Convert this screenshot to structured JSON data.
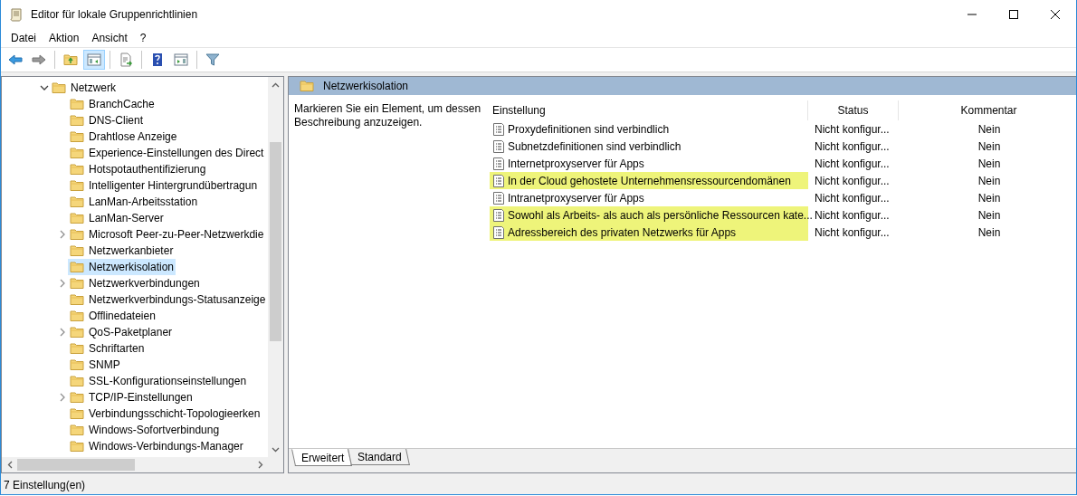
{
  "window": {
    "title": "Editor für lokale Gruppenrichtlinien"
  },
  "menu": [
    "Datei",
    "Aktion",
    "Ansicht",
    "?"
  ],
  "toolbar": [
    {
      "kind": "back",
      "pressed": false
    },
    {
      "kind": "forward",
      "pressed": false
    },
    {
      "kind": "sep"
    },
    {
      "kind": "up",
      "pressed": false
    },
    {
      "kind": "tree",
      "pressed": true
    },
    {
      "kind": "sep"
    },
    {
      "kind": "export",
      "pressed": false
    },
    {
      "kind": "sep"
    },
    {
      "kind": "help",
      "pressed": false
    },
    {
      "kind": "actionpane",
      "pressed": false
    },
    {
      "kind": "sep"
    },
    {
      "kind": "filter",
      "pressed": false
    }
  ],
  "tree": {
    "label": "Netzwerk",
    "expanded": true,
    "selected": false,
    "children": [
      {
        "label": "BranchCache",
        "expandable": false,
        "selected": false
      },
      {
        "label": "DNS-Client",
        "expandable": false,
        "selected": false
      },
      {
        "label": "Drahtlose Anzeige",
        "expandable": false,
        "selected": false
      },
      {
        "label": "Experience-Einstellungen des Direct",
        "expandable": false,
        "selected": false
      },
      {
        "label": "Hotspotauthentifizierung",
        "expandable": false,
        "selected": false
      },
      {
        "label": "Intelligenter Hintergrundübertragun",
        "expandable": false,
        "selected": false
      },
      {
        "label": "LanMan-Arbeitsstation",
        "expandable": false,
        "selected": false
      },
      {
        "label": "LanMan-Server",
        "expandable": false,
        "selected": false
      },
      {
        "label": "Microsoft Peer-zu-Peer-Netzwerkdie",
        "expandable": true,
        "selected": false
      },
      {
        "label": "Netzwerkanbieter",
        "expandable": false,
        "selected": false
      },
      {
        "label": "Netzwerkisolation",
        "expandable": false,
        "selected": true
      },
      {
        "label": "Netzwerkverbindungen",
        "expandable": true,
        "selected": false
      },
      {
        "label": "Netzwerkverbindungs-Statusanzeige",
        "expandable": false,
        "selected": false
      },
      {
        "label": "Offlinedateien",
        "expandable": false,
        "selected": false
      },
      {
        "label": "QoS-Paketplaner",
        "expandable": true,
        "selected": false
      },
      {
        "label": "Schriftarten",
        "expandable": false,
        "selected": false
      },
      {
        "label": "SNMP",
        "expandable": false,
        "selected": false
      },
      {
        "label": "SSL-Konfigurationseinstellungen",
        "expandable": false,
        "selected": false
      },
      {
        "label": "TCP/IP-Einstellungen",
        "expandable": true,
        "selected": false
      },
      {
        "label": "Verbindungsschicht-Topologieerken",
        "expandable": false,
        "selected": false
      },
      {
        "label": "Windows-Sofortverbindung",
        "expandable": false,
        "selected": false
      },
      {
        "label": "Windows-Verbindungs-Manager",
        "expandable": false,
        "selected": false
      }
    ]
  },
  "details": {
    "title": "Netzwerkisolation",
    "description": "Markieren Sie ein Element, um dessen Beschreibung anzuzeigen.",
    "columns": [
      "Einstellung",
      "Status",
      "Kommentar"
    ],
    "rows": [
      {
        "setting": "Proxydefinitionen sind verbindlich",
        "status": "Nicht konfigur...",
        "comment": "Nein",
        "highlighted": false
      },
      {
        "setting": "Subnetzdefinitionen sind verbindlich",
        "status": "Nicht konfigur...",
        "comment": "Nein",
        "highlighted": false
      },
      {
        "setting": "Internetproxyserver für Apps",
        "status": "Nicht konfigur...",
        "comment": "Nein",
        "highlighted": false
      },
      {
        "setting": "In der Cloud gehostete Unternehmensressourcendomänen",
        "status": "Nicht konfigur...",
        "comment": "Nein",
        "highlighted": true
      },
      {
        "setting": "Intranetproxyserver für Apps",
        "status": "Nicht konfigur...",
        "comment": "Nein",
        "highlighted": false
      },
      {
        "setting": "Sowohl als Arbeits- als auch als persönliche Ressourcen kate...",
        "status": "Nicht konfigur...",
        "comment": "Nein",
        "highlighted": true
      },
      {
        "setting": "Adressbereich des privaten Netzwerks für Apps",
        "status": "Nicht konfigur...",
        "comment": "Nein",
        "highlighted": true
      }
    ]
  },
  "view_tabs": [
    {
      "label": "Erweitert",
      "selected": true
    },
    {
      "label": "Standard",
      "selected": false
    }
  ],
  "status_bar": "7 Einstellung(en)"
}
